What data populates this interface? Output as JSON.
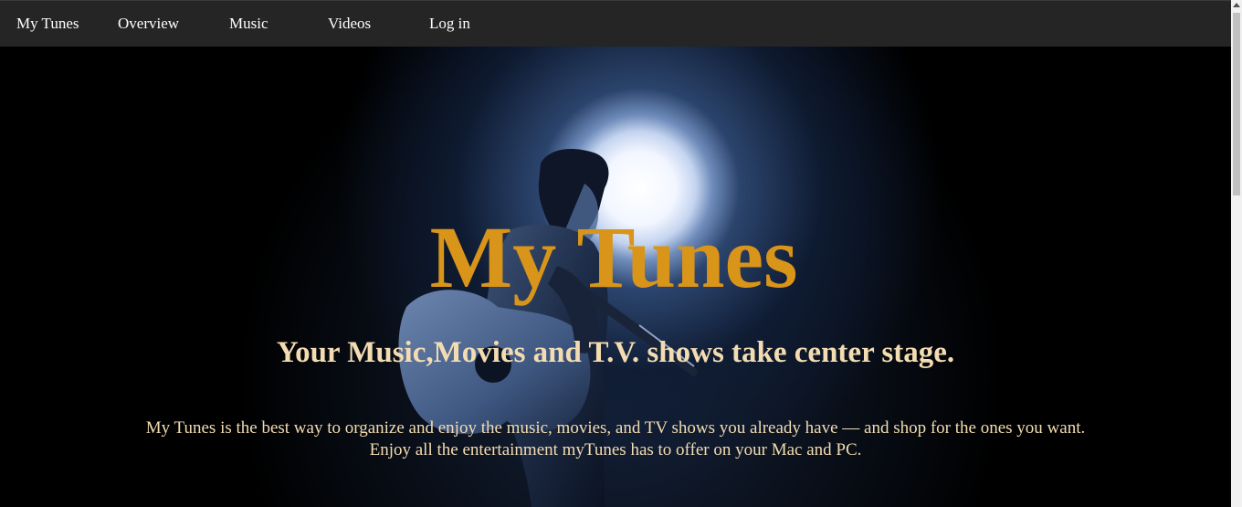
{
  "navbar": {
    "brand": "My Tunes",
    "items": [
      {
        "label": "Overview"
      },
      {
        "label": "Music"
      },
      {
        "label": "Videos"
      },
      {
        "label": "Log in"
      }
    ]
  },
  "hero": {
    "title": "My Tunes",
    "subtitle": "Your Music,Movies and T.V. shows take center stage.",
    "description_line1": "My Tunes is the best way to organize and enjoy the music, movies, and TV shows you already have — and shop for the ones you want.",
    "description_line2": "Enjoy all the entertainment myTunes has to offer on your Mac and PC."
  },
  "colors": {
    "navbar_bg": "#252525",
    "title": "#d9941a",
    "subtitle": "#f3dcb1",
    "hero_bg": "#000000",
    "spotlight": "#ffffff"
  }
}
